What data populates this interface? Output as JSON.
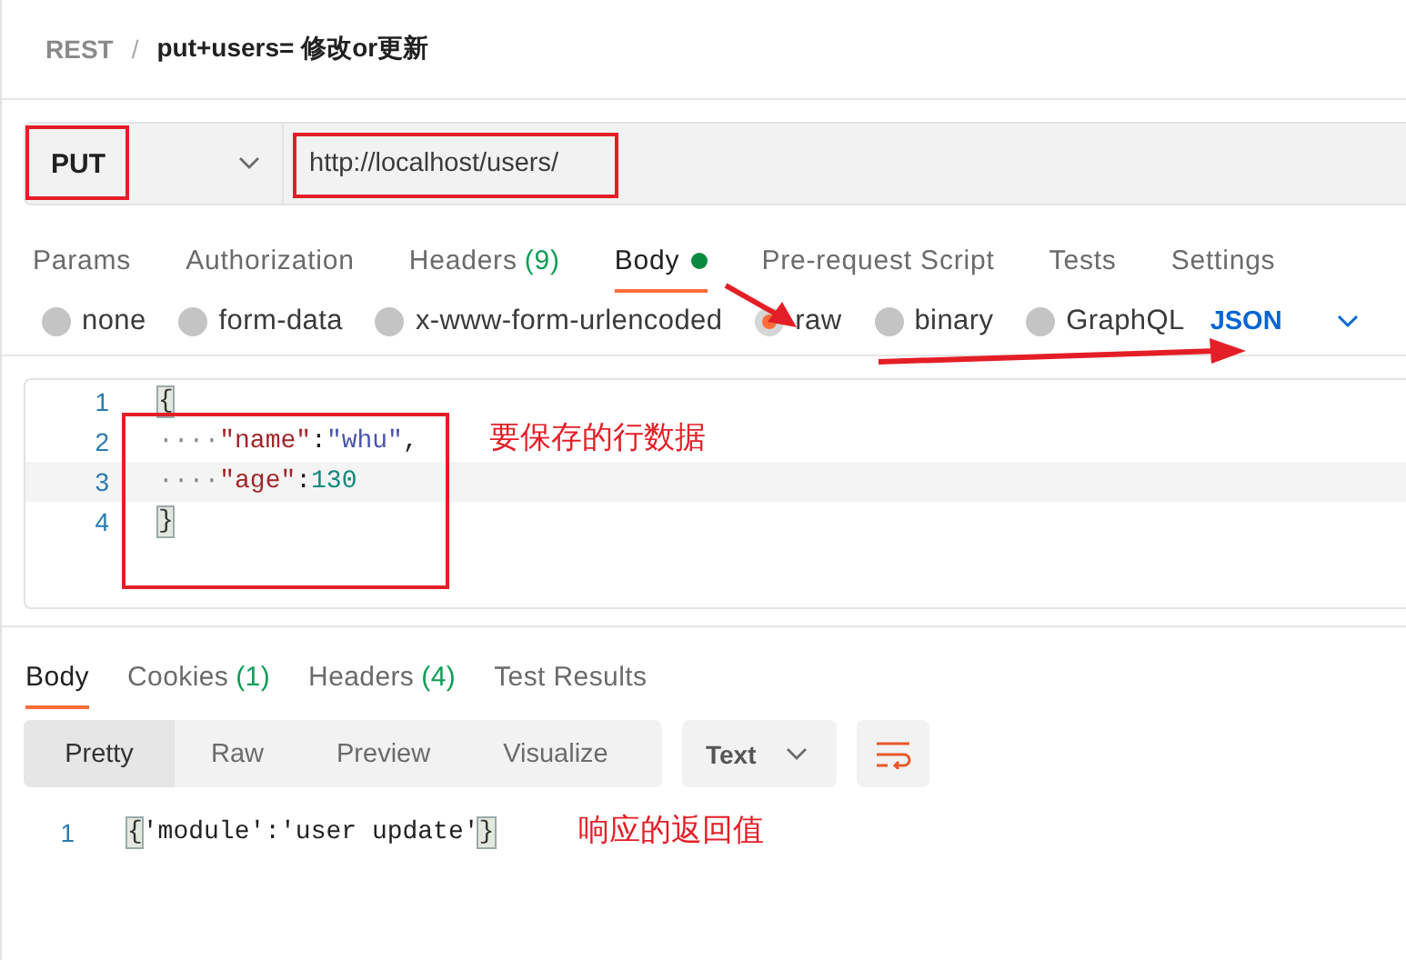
{
  "breadcrumb": {
    "collection": "REST",
    "separator": "/",
    "request": "put+users= 修改or更新"
  },
  "request": {
    "method": "PUT",
    "url": "http://localhost/users/"
  },
  "request_tabs": [
    {
      "label": "Params",
      "selected": false
    },
    {
      "label": "Authorization",
      "selected": false
    },
    {
      "label": "Headers",
      "count": "(9)",
      "selected": false
    },
    {
      "label": "Body",
      "selected": true,
      "dot": true
    },
    {
      "label": "Pre-request Script",
      "selected": false
    },
    {
      "label": "Tests",
      "selected": false
    },
    {
      "label": "Settings",
      "selected": false
    }
  ],
  "body_types": [
    {
      "label": "none",
      "selected": false
    },
    {
      "label": "form-data",
      "selected": false
    },
    {
      "label": "x-www-form-urlencoded",
      "selected": false
    },
    {
      "label": "raw",
      "selected": true
    },
    {
      "label": "binary",
      "selected": false
    },
    {
      "label": "GraphQL",
      "selected": false
    }
  ],
  "body_format": "JSON",
  "editor": {
    "lines": [
      {
        "number": "1",
        "tokens": [
          {
            "kind": "brace",
            "text": "{"
          }
        ]
      },
      {
        "number": "2",
        "tokens": [
          {
            "kind": "indent",
            "text": "····"
          },
          {
            "kind": "key",
            "text": "\"name\""
          },
          {
            "kind": "punct",
            "text": ":"
          },
          {
            "kind": "string",
            "text": "\"whu\""
          },
          {
            "kind": "punct",
            "text": ","
          }
        ]
      },
      {
        "number": "3",
        "tokens": [
          {
            "kind": "indent",
            "text": "····"
          },
          {
            "kind": "key",
            "text": "\"age\""
          },
          {
            "kind": "punct",
            "text": ":"
          },
          {
            "kind": "number",
            "text": "130"
          }
        ]
      },
      {
        "number": "4",
        "tokens": [
          {
            "kind": "brace",
            "text": "}"
          }
        ]
      }
    ],
    "note": "要保存的行数据"
  },
  "response_tabs": [
    {
      "label": "Body",
      "selected": true
    },
    {
      "label": "Cookies",
      "count": "(1)",
      "selected": false
    },
    {
      "label": "Headers",
      "count": "(4)",
      "selected": false
    },
    {
      "label": "Test Results",
      "selected": false
    }
  ],
  "view_modes": [
    {
      "label": "Pretty",
      "selected": true
    },
    {
      "label": "Raw",
      "selected": false
    },
    {
      "label": "Preview",
      "selected": false
    },
    {
      "label": "Visualize",
      "selected": false
    }
  ],
  "response_format": "Text",
  "response": {
    "lines": [
      {
        "number": "1",
        "tokens": [
          {
            "kind": "brace",
            "text": "{"
          },
          {
            "kind": "string",
            "text": "'module'"
          },
          {
            "kind": "punct",
            "text": ":"
          },
          {
            "kind": "string",
            "text": "'user update'"
          },
          {
            "kind": "brace",
            "text": "}"
          }
        ]
      }
    ],
    "note": "响应的返回值"
  }
}
